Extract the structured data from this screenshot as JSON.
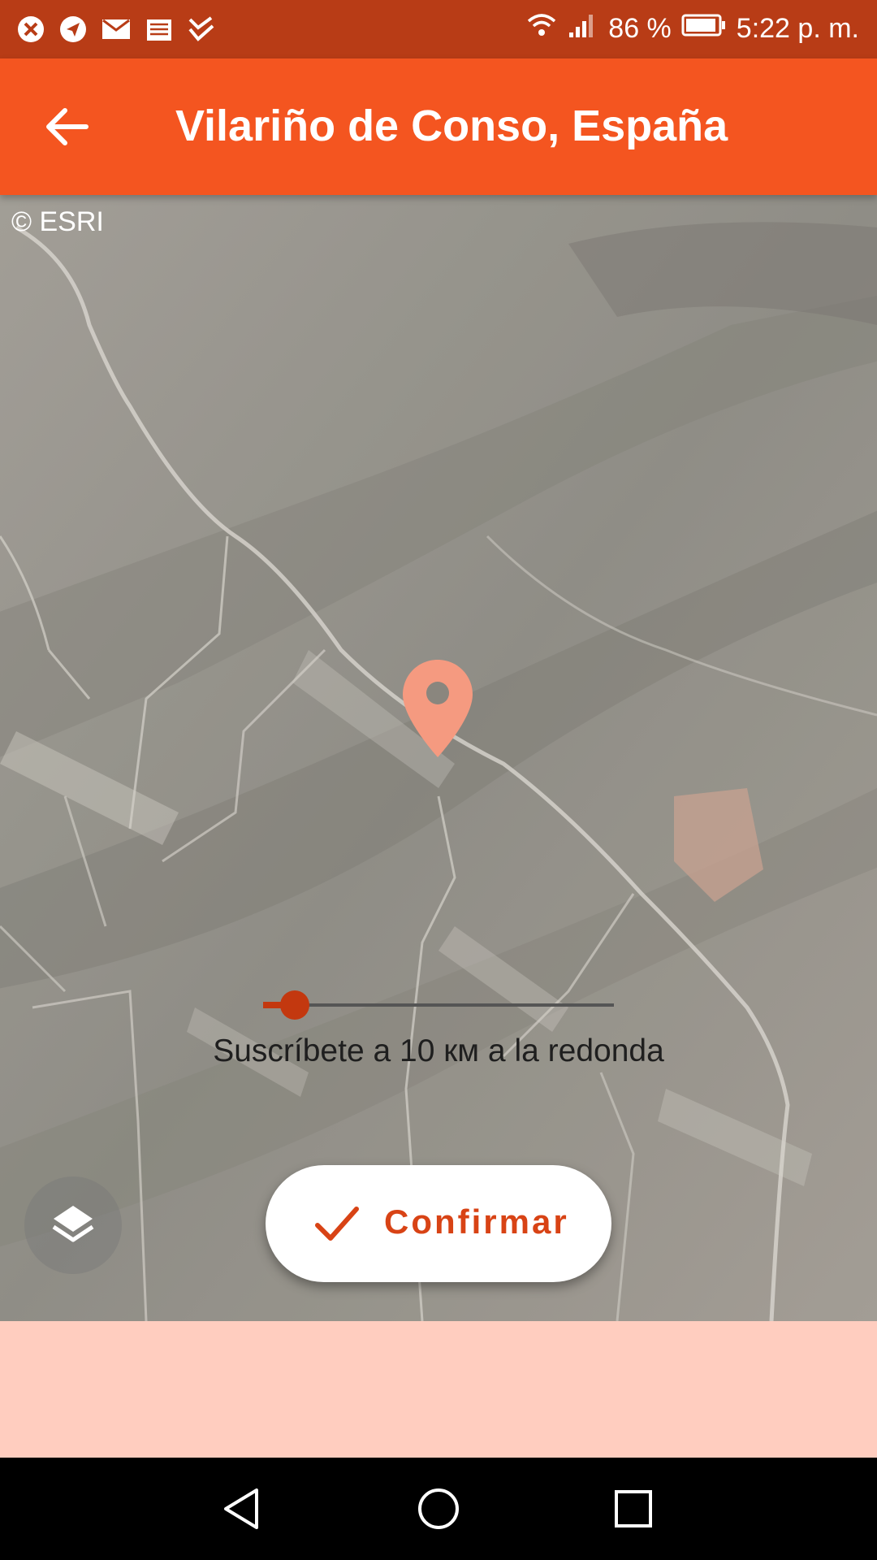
{
  "status_bar": {
    "battery_text": "86 %",
    "time": "5:22 p. m.",
    "notification_icons": [
      "close-circle-icon",
      "send-icon",
      "mail-icon",
      "news-icon",
      "check-icon"
    ],
    "status_icons": [
      "wifi-icon",
      "signal-icon",
      "battery-icon"
    ]
  },
  "app_bar": {
    "title": "Vilariño de Conso, España",
    "back_icon": "arrow-left-icon"
  },
  "map": {
    "attribution": "© ESRI",
    "pin_icon": "map-pin-icon",
    "pin_color": "#f59a80"
  },
  "radius": {
    "label": "Suscríbete a 10 км a la redonda",
    "slider_fraction": 0.09,
    "accent_color": "#c3380f"
  },
  "actions": {
    "confirm_label": "Confirmar",
    "confirm_icon": "check-icon",
    "layers_icon": "layers-icon"
  },
  "nav_bar": {
    "icons": [
      "back-triangle-icon",
      "home-circle-icon",
      "recents-square-icon"
    ]
  },
  "colors": {
    "app_bar": "#f45520",
    "status_bar": "#b83c16",
    "bottom_panel": "#ffcdbf"
  }
}
